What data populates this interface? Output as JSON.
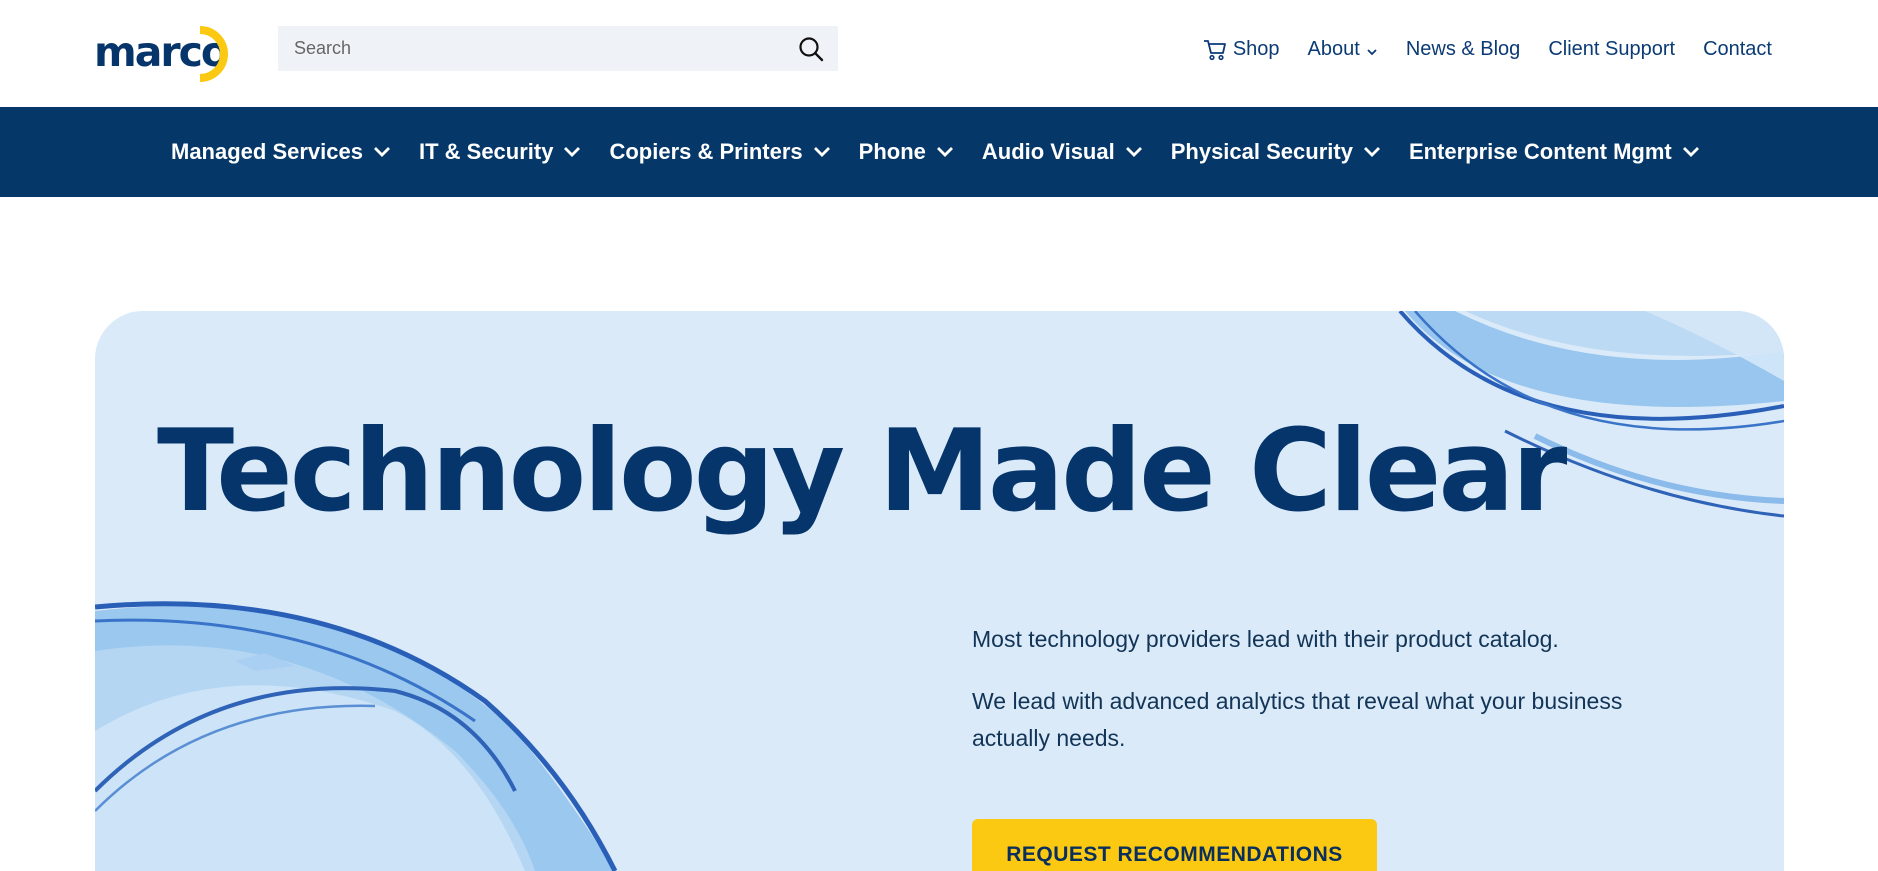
{
  "brand": {
    "logo_text": "marco",
    "accent_color": "#fbc912",
    "primary_color": "#06356b"
  },
  "search": {
    "placeholder": "Search",
    "icon": "search-icon"
  },
  "utility_nav": {
    "shop": {
      "label": "Shop",
      "icon": "cart-icon"
    },
    "about": {
      "label": "About",
      "icon": "chevron-down-icon"
    },
    "news": {
      "label": "News & Blog"
    },
    "support": {
      "label": "Client Support"
    },
    "contact": {
      "label": "Contact"
    }
  },
  "main_nav": {
    "background": "#053769",
    "items": [
      {
        "label": "Managed Services"
      },
      {
        "label": "IT & Security"
      },
      {
        "label": "Copiers & Printers"
      },
      {
        "label": "Phone"
      },
      {
        "label": "Audio Visual"
      },
      {
        "label": "Physical Security"
      },
      {
        "label": "Enterprise Content Mgmt"
      }
    ]
  },
  "hero": {
    "background": "#daeaf9",
    "title": "Technology Made Clear",
    "paragraph_1": "Most technology providers lead with their product catalog.",
    "paragraph_2": "We lead with advanced analytics that reveal what your business actually needs.",
    "cta_label": "REQUEST RECOMMENDATIONS"
  }
}
